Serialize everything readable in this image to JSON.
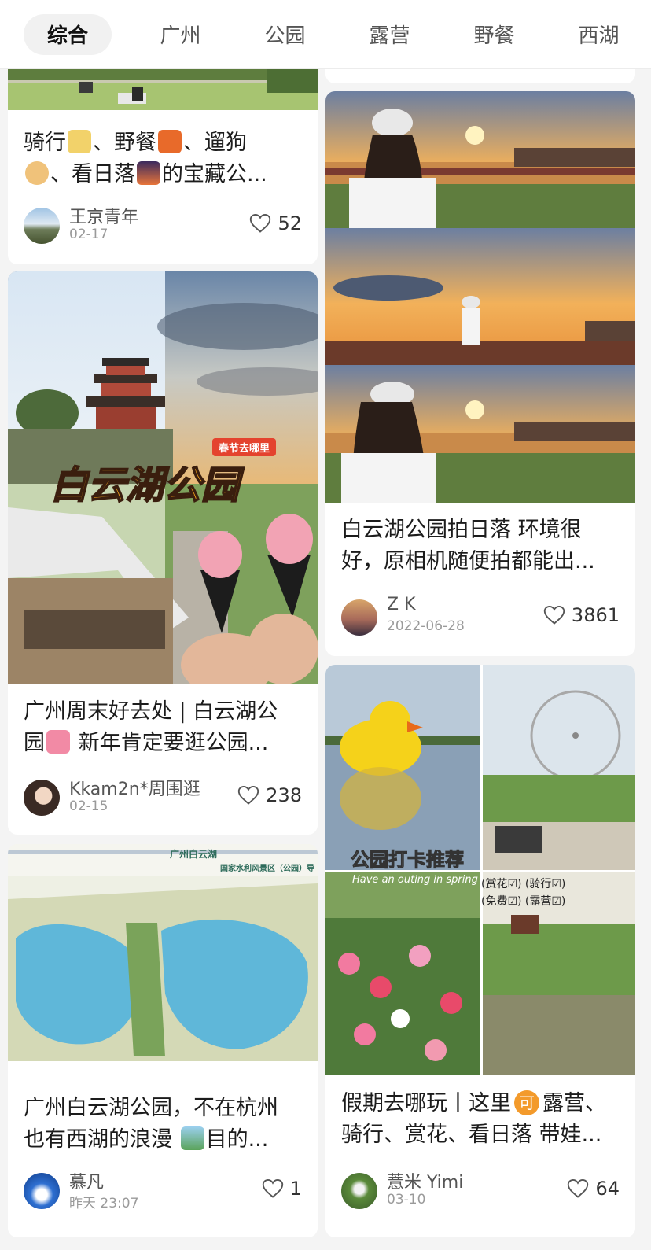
{
  "tabs": [
    "综合",
    "广州",
    "公园",
    "露营",
    "野餐",
    "西湖"
  ],
  "active_tab": "综合",
  "cards": [
    {
      "title_line1": "骑行",
      "title_line1_b": "、野餐",
      "title_line1_c": "、遛狗",
      "title_line2_b": "、看日落",
      "title_line2_c": "的宝藏公...",
      "author": "王京青年",
      "date": "02-17",
      "likes": "52"
    },
    {
      "overlay_tag": "春节去哪里",
      "overlay_title": "白云湖公园",
      "title_line1": "广州周末好去处 | 白云湖公",
      "title_line2_a": "园",
      "title_line2_b": " 新年肯定要逛公园...",
      "author": "Kkam2n*周围逛",
      "date": "02-15",
      "likes": "238"
    },
    {
      "map_heading": "广州白云湖",
      "map_subheading": "国家水利风景区（公园）导",
      "title_line1": "广州白云湖公园，不在杭州",
      "title_line2_a": "也有西湖的浪漫",
      "title_line2_b": "目的...",
      "author": "慕凡",
      "date": "昨天 23:07",
      "likes": "1"
    },
    {
      "title_line1": "白云湖公园拍日落 环境很",
      "title_line2": "好，原相机随便拍都能出...",
      "author": "Z K",
      "date": "2022-06-28",
      "likes": "3861"
    },
    {
      "overlay_title": "公园打卡推荐",
      "overlay_sub": "Have an outing in spring",
      "overlay_tags_1": "(赏花☑) (骑行☑)",
      "overlay_tags_2": "(免费☑) (露营☑)",
      "title_line1_a": "假期去哪玩丨这里",
      "title_line1_badge": "可",
      "title_line1_b": "露营、",
      "title_line2": "骑行、赏花、看日落 带娃...",
      "author": "薏米 Yimi",
      "date": "03-10",
      "likes": "64"
    }
  ],
  "colors": {
    "accent_badge": "#f39a2b",
    "overlay_title": "#f4a21b",
    "tag_bg": "#e4432e"
  }
}
